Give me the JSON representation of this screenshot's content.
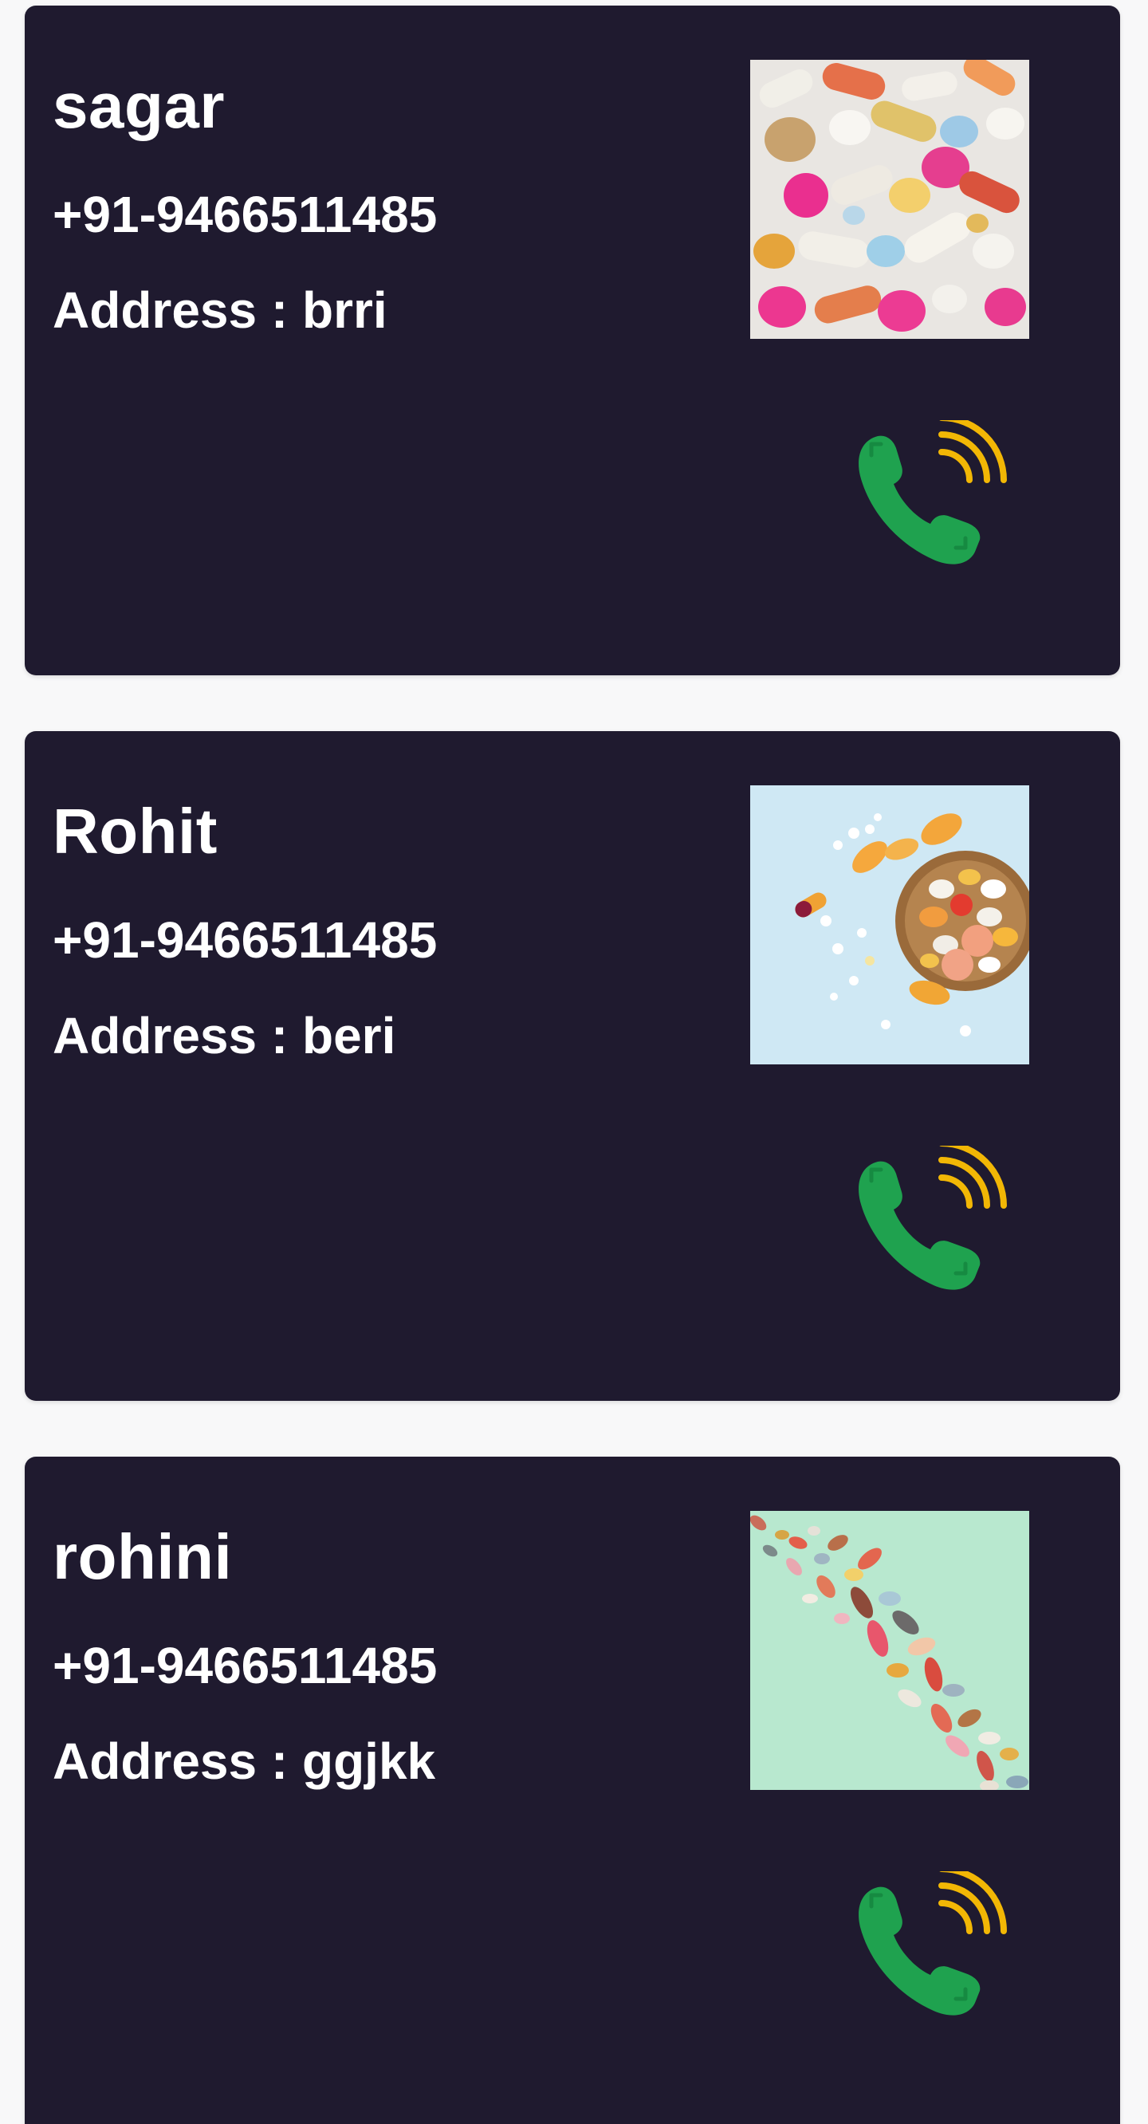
{
  "contacts": [
    {
      "name": "sagar",
      "phone": "+91-9466511485",
      "address": "Address : brri",
      "image_icon": "pills-mixed-image",
      "call_icon": "phone-call-icon"
    },
    {
      "name": "Rohit",
      "phone": "+91-9466511485",
      "address": "Address : beri",
      "image_icon": "pills-bowl-image",
      "call_icon": "phone-call-icon"
    },
    {
      "name": "rohini",
      "phone": "+91-9466511485",
      "address": "Address : ggjkk",
      "image_icon": "pills-strand-image",
      "call_icon": "phone-call-icon"
    }
  ],
  "colors": {
    "card_background": "#1f1a2f",
    "page_background": "#f8f8f9",
    "text": "#ffffff",
    "phone_icon": "#1fa24f",
    "signal_waves": "#f2b705"
  }
}
